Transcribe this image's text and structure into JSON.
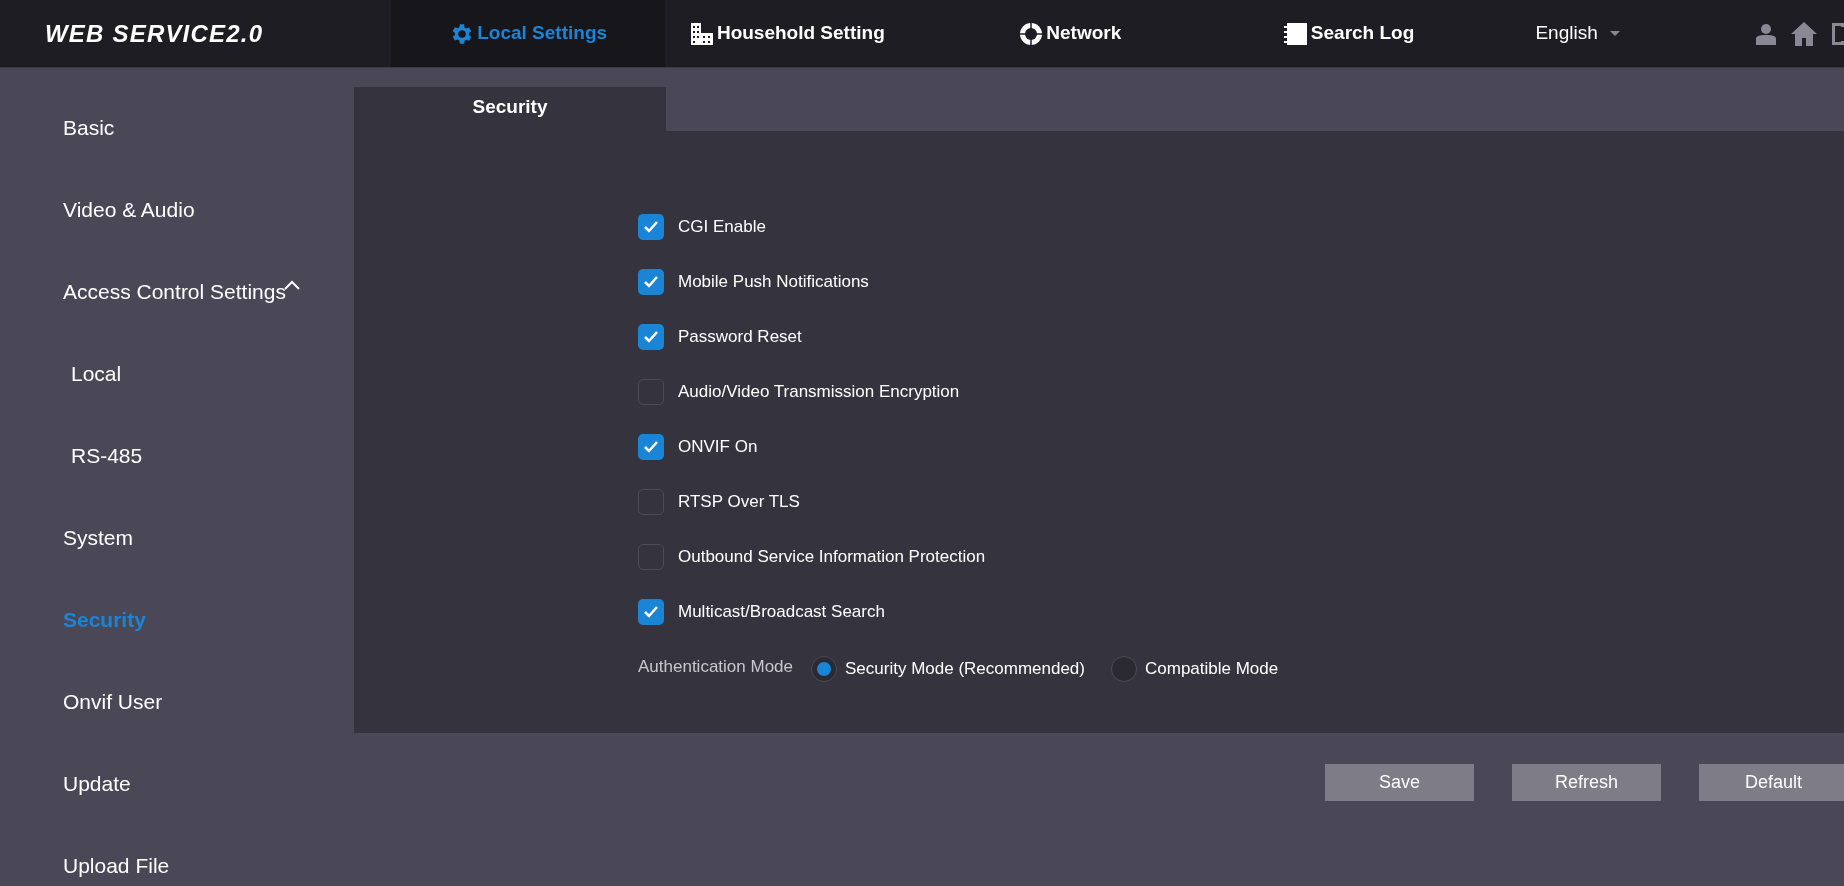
{
  "header": {
    "logo": "WEB SERVICE2.0",
    "nav": [
      {
        "label": "Local Settings",
        "selected": true
      },
      {
        "label": "Household Setting",
        "selected": false
      },
      {
        "label": "Network",
        "selected": false
      },
      {
        "label": "Search Log",
        "selected": false
      }
    ],
    "language": "English"
  },
  "sidebar": {
    "items": [
      {
        "label": "Basic",
        "selected": false
      },
      {
        "label": "Video & Audio",
        "selected": false
      },
      {
        "label": "Access Control Settings",
        "selected": false,
        "expanded": true,
        "children": [
          {
            "label": "Local",
            "selected": false
          },
          {
            "label": "RS-485",
            "selected": false
          }
        ]
      },
      {
        "label": "System",
        "selected": false
      },
      {
        "label": "Security",
        "selected": true
      },
      {
        "label": "Onvif User",
        "selected": false
      },
      {
        "label": "Update",
        "selected": false
      },
      {
        "label": "Upload File",
        "selected": false
      }
    ]
  },
  "tabs": [
    {
      "label": "Security",
      "selected": true
    }
  ],
  "options": [
    {
      "label": "CGI Enable",
      "checked": true
    },
    {
      "label": "Mobile Push Notifications",
      "checked": true
    },
    {
      "label": "Password Reset",
      "checked": true
    },
    {
      "label": "Audio/Video Transmission Encryption",
      "checked": false
    },
    {
      "label": "ONVIF On",
      "checked": true
    },
    {
      "label": "RTSP Over TLS",
      "checked": false
    },
    {
      "label": "Outbound Service Information Protection",
      "checked": false
    },
    {
      "label": "Multicast/Broadcast Search",
      "checked": true
    }
  ],
  "authentication": {
    "label": "Authentication Mode",
    "choices": [
      {
        "label": "Security Mode (Recommended)",
        "selected": true
      },
      {
        "label": "Compatible Mode",
        "selected": false
      }
    ]
  },
  "buttons": [
    "Save",
    "Refresh",
    "Default"
  ]
}
